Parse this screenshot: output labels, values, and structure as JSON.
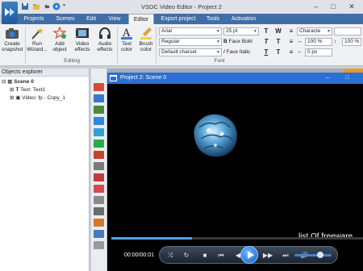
{
  "window": {
    "title": "VSDC Video Editor - Project 2"
  },
  "menu": {
    "tabs": [
      "Projects",
      "Scenes",
      "Edit",
      "View",
      "Editor",
      "Export project",
      "Tools",
      "Activation"
    ],
    "active": "Editor"
  },
  "ribbon": {
    "create_snapshot": "Create snapshot",
    "run_wizard": "Run Wizard...",
    "add_object": "Add object",
    "video_effects": "Video effects",
    "audio_effects": "Audio effects",
    "text_color": "Text color",
    "brush_color": "Brush color",
    "editing_label": "Editing",
    "font_label": "Font",
    "font_name": "Arial",
    "font_size": "25 pt",
    "font_style": "Regular",
    "charset": "Default charset",
    "faux_bold": "Faux Bold",
    "faux_italic": "Faux Italic",
    "character_label": "Characte",
    "scale_h": "100 %",
    "scale_v": "100 %",
    "spacing": "0 px"
  },
  "explorer": {
    "title": "Objects explorer",
    "items": [
      {
        "label": "Scene 0"
      },
      {
        "label": "Text: Text1"
      },
      {
        "label": "Video: fp - Copy_1"
      }
    ]
  },
  "player": {
    "title": "Project 2: Scene 0",
    "overlay_text": "list  Of freeware",
    "timecode": "00:00/00:01",
    "progress": 0.32,
    "volume": 0.7
  },
  "colors": {
    "accent": "#3f6fa6",
    "player_title": "#2c6fd6"
  }
}
